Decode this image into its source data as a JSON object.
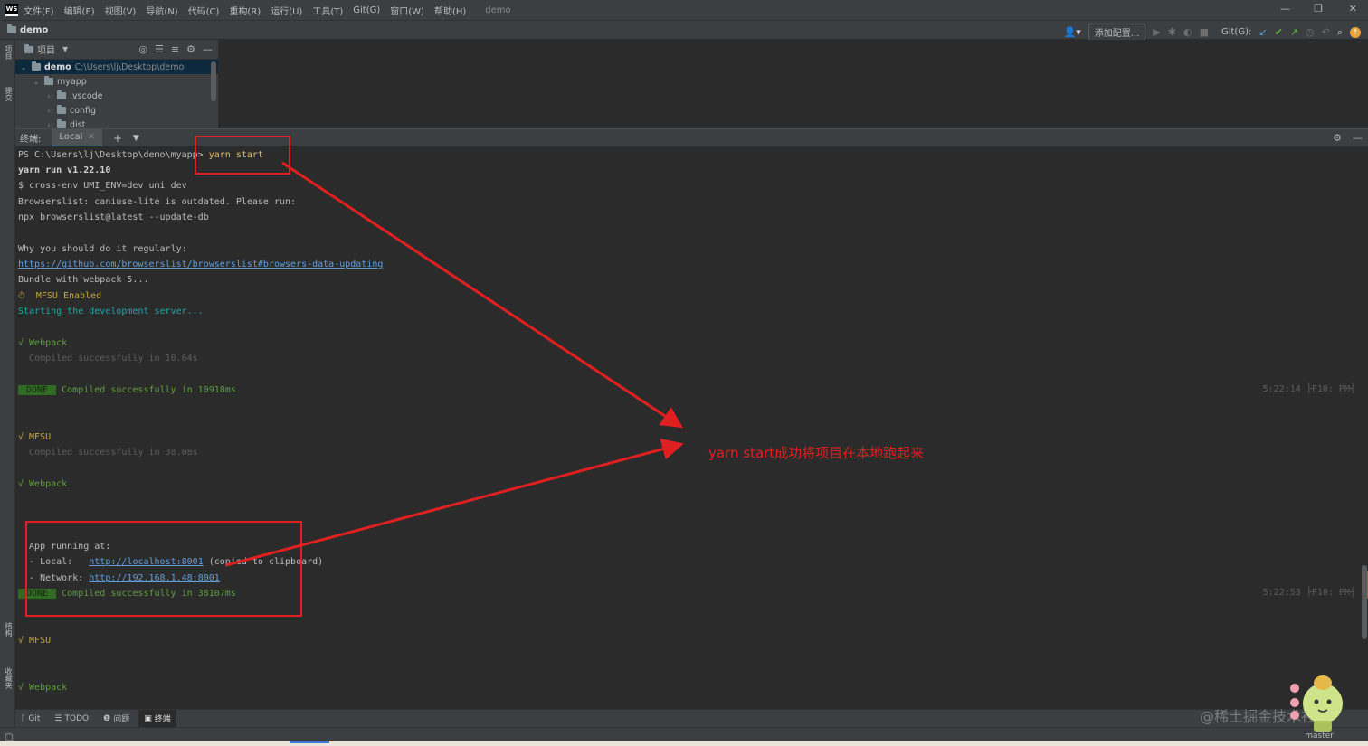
{
  "menubar": {
    "logo": "WS",
    "items": [
      "文件(F)",
      "编辑(E)",
      "视图(V)",
      "导航(N)",
      "代码(C)",
      "重构(R)",
      "运行(U)",
      "工具(T)",
      "Git(G)",
      "窗口(W)",
      "帮助(H)"
    ],
    "window_title": "demo",
    "controls": {
      "minimize": "—",
      "maximize": "❐",
      "close": "✕"
    }
  },
  "navbar": {
    "project": "demo",
    "add_config": "添加配置...",
    "git_label": "Git(G):",
    "update_badge": "↑"
  },
  "left_stripe": {
    "project": "项目",
    "commit": "提交",
    "structure": "结构",
    "favorites": "收藏夹"
  },
  "project_panel": {
    "header": "项目",
    "tree": [
      {
        "name": "demo",
        "path": "C:\\Users\\lj\\Desktop\\demo",
        "expanded": true,
        "depth": 0
      },
      {
        "name": "myapp",
        "path": "",
        "expanded": true,
        "depth": 1
      },
      {
        "name": ".vscode",
        "path": "",
        "expanded": false,
        "depth": 2
      },
      {
        "name": "config",
        "path": "",
        "expanded": false,
        "depth": 2
      },
      {
        "name": "dist",
        "path": "",
        "expanded": false,
        "depth": 2
      }
    ]
  },
  "terminal": {
    "title": "终端:",
    "tab": "Local",
    "prompt": "PS C:\\Users\\lj\\Desktop\\demo\\myapp> ",
    "command": "yarn start",
    "lines": {
      "yarn_run": "yarn run v1.22.10",
      "cross_env": "$ cross-env UMI_ENV=dev umi dev",
      "browserslist": "Browserslist: caniuse-lite is outdated. Please run:",
      "npx": "npx browserslist@latest --update-db",
      "why": "Why you should do it regularly:",
      "link": "https://github.com/browserslist/browserslist#browsers-data-updating",
      "bundle": "Bundle with webpack 5...",
      "mfsu_enabled": "⏱  MFSU Enabled",
      "starting": "Starting the development server...",
      "webpack_1": "√ Webpack",
      "compiled_1": "  Compiled successfully in 10.64s",
      "done_1_badge": " DONE ",
      "done_1_text": " Compiled successfully in 10918ms",
      "ts_1": "5:22:14 ├F10: PM┤",
      "mfsu_1": "√ MFSU",
      "compiled_2": "  Compiled successfully in 38.08s",
      "webpack_2": "√ Webpack",
      "app_running": "  App running at:",
      "local_label": "  - Local:   ",
      "local_url": "http://localhost:8001",
      "local_suffix": " (copied to clipboard)",
      "network_label": "  - Network: ",
      "network_url": "http://192.168.1.48:8001",
      "done_2_badge": " DONE ",
      "done_2_text": " Compiled successfully in 38107ms",
      "ts_2": "5:22:53 ├F10: PM┤",
      "mfsu_2": "√ MFSU",
      "webpack_3": "√ Webpack"
    }
  },
  "annotation": {
    "label": "yarn start成功将项目在本地跑起来",
    "color": "#e02020"
  },
  "bottom_tools": {
    "git": "Git",
    "todo": "TODO",
    "problems": "问题",
    "terminal": "终端"
  },
  "status": {
    "branch": "master"
  },
  "watermark": "@稀土掘金技术社区"
}
